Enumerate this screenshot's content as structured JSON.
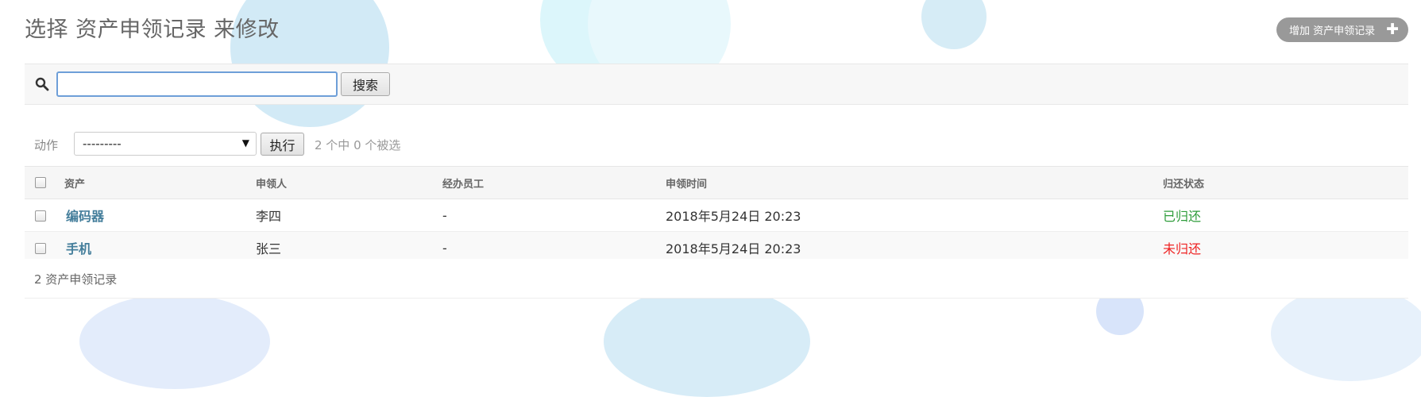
{
  "page": {
    "title": "选择 资产申领记录 来修改"
  },
  "toolbar": {
    "add_label": "增加 资产申领记录",
    "add_icon": "plus-icon"
  },
  "search": {
    "value": "",
    "placeholder": "",
    "button_label": "搜索",
    "icon": "search-icon"
  },
  "actions": {
    "label": "动作",
    "selected_option": "---------",
    "run_label": "执行",
    "selection_count": "2 个中 0 个被选"
  },
  "table": {
    "columns": [
      "资产",
      "申领人",
      "经办员工",
      "申领时间",
      "归还状态"
    ],
    "rows": [
      {
        "asset": "编码器",
        "applicant": "李四",
        "handler": "-",
        "time": "2018年5月24日 20:23",
        "status": "已归还"
      },
      {
        "asset": "手机",
        "applicant": "张三",
        "handler": "-",
        "time": "2018年5月24日 20:23",
        "status": "未归还"
      }
    ]
  },
  "footer": {
    "count_text": "2 资产申领记录"
  },
  "colors": {
    "link": "#447e9b",
    "status_returned": "#2e9c3a",
    "status_not_returned": "#ee2222",
    "add_button_bg": "#999999",
    "search_focus_border": "#6e9fd8"
  }
}
